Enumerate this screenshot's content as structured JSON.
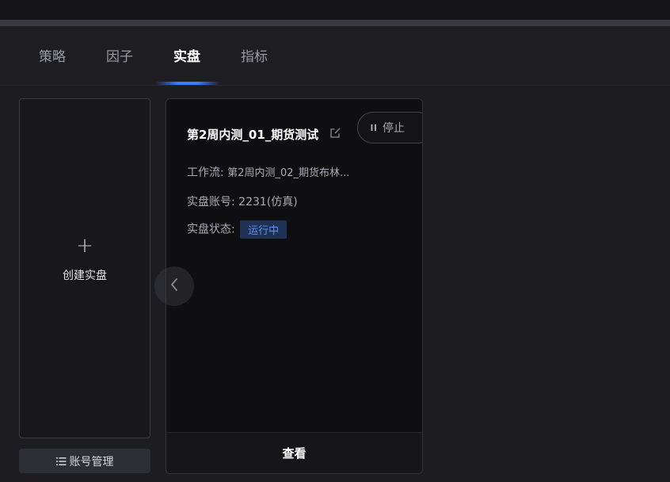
{
  "tabs": [
    {
      "label": "策略",
      "active": false
    },
    {
      "label": "因子",
      "active": false
    },
    {
      "label": "实盘",
      "active": true
    },
    {
      "label": "指标",
      "active": false
    }
  ],
  "create_card": {
    "plus": "+",
    "label": "创建实盘"
  },
  "account_button": {
    "icon": "list-icon",
    "label": "账号管理"
  },
  "live_card": {
    "title": "第2周内测_01_期货测试",
    "edit_icon": "edit-icon",
    "stop_button": {
      "icon": "pause-icon",
      "label": "停止"
    },
    "workflow_label": "工作流:",
    "workflow_value": "第2周内测_02_期货布林...",
    "account_label": "实盘账号:",
    "account_value": "2231(仿真)",
    "status_label": "实盘状态:",
    "status_value": "运行中",
    "footer_label": "查看"
  },
  "nav": {
    "prev_icon": "chevron-left-icon"
  },
  "colors": {
    "accent": "#3b7cff",
    "status_bg": "#1f3154",
    "status_text": "#5c8ff0",
    "background": "#1c1c21",
    "card_bg": "#0f0f12"
  }
}
